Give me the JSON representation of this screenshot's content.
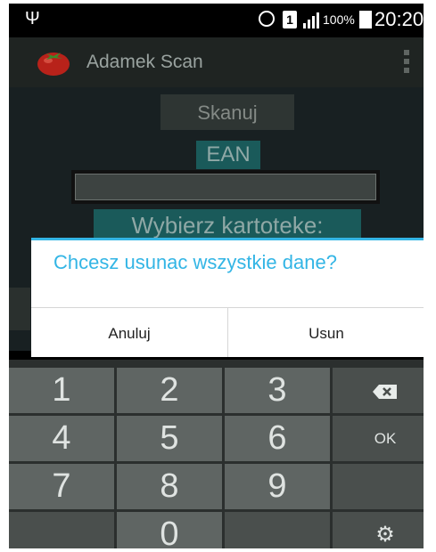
{
  "status_bar": {
    "battery_percent": "100%",
    "time": "20:20"
  },
  "action_bar": {
    "app_title": "Adamek Scan",
    "app_icon": "tomato-icon",
    "menu_icon": "overflow-menu-icon"
  },
  "content": {
    "scan_button_label": "Skanuj",
    "ean_label": "EAN",
    "ean_value": "",
    "card_label": "Wybierz kartoteke:"
  },
  "dialog": {
    "title": "Chcesz usunac wszystkie dane?",
    "cancel_label": "Anuluj",
    "confirm_label": "Usun",
    "accent_color": "#33b5e5"
  },
  "keypad": {
    "rows": [
      [
        "1",
        "2",
        "3",
        "⌫"
      ],
      [
        "4",
        "5",
        "6",
        "OK"
      ],
      [
        "7",
        "8",
        "9",
        ""
      ],
      [
        "",
        "0",
        "",
        "⚙"
      ]
    ]
  }
}
